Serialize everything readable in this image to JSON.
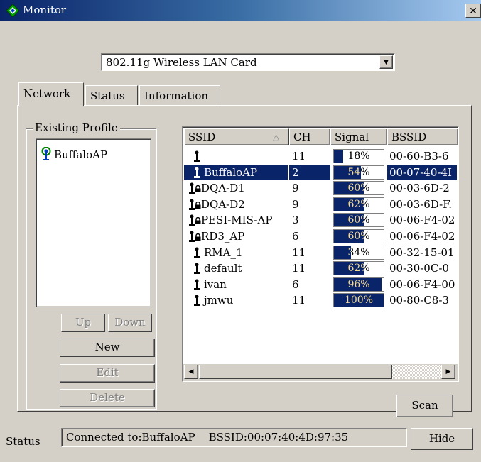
{
  "window": {
    "title": "Monitor",
    "close": "✕"
  },
  "adapter": {
    "selected": "802.11g Wireless LAN Card",
    "arrow": "▼"
  },
  "tabs": [
    "Network",
    "Status",
    "Information"
  ],
  "profiles": {
    "legend": "Existing Profile",
    "items": [
      "BuffaloAP"
    ],
    "buttons": {
      "up": "Up",
      "down": "Down",
      "new": "New",
      "edit": "Edit",
      "delete": "Delete"
    }
  },
  "table": {
    "headers": {
      "ssid": "SSID",
      "ch": "CH",
      "signal": "Signal",
      "bssid": "BSSID",
      "sort_icon": "△"
    },
    "rows": [
      {
        "ssid": "",
        "ch": "11",
        "signal": "18%",
        "signal_value": 18,
        "bssid": "00-60-B3-6",
        "secured": false,
        "selected": false
      },
      {
        "ssid": "BuffaloAP",
        "ch": "2",
        "signal": "54%",
        "signal_value": 54,
        "bssid": "00-07-40-4I",
        "secured": false,
        "selected": true
      },
      {
        "ssid": "DQA-D1",
        "ch": "9",
        "signal": "60%",
        "signal_value": 60,
        "bssid": "00-03-6D-2",
        "secured": true,
        "selected": false
      },
      {
        "ssid": "DQA-D2",
        "ch": "9",
        "signal": "62%",
        "signal_value": 62,
        "bssid": "00-03-6D-F.",
        "secured": true,
        "selected": false
      },
      {
        "ssid": "PESI-MIS-AP",
        "ch": "3",
        "signal": "60%",
        "signal_value": 60,
        "bssid": "00-06-F4-02",
        "secured": true,
        "selected": false
      },
      {
        "ssid": "RD3_AP",
        "ch": "6",
        "signal": "60%",
        "signal_value": 60,
        "bssid": "00-06-F4-02",
        "secured": true,
        "selected": false
      },
      {
        "ssid": "RMA_1",
        "ch": "11",
        "signal": "34%",
        "signal_value": 34,
        "bssid": "00-32-15-01",
        "secured": false,
        "selected": false
      },
      {
        "ssid": "default",
        "ch": "11",
        "signal": "62%",
        "signal_value": 62,
        "bssid": "00-30-0C-0",
        "secured": false,
        "selected": false
      },
      {
        "ssid": "ivan",
        "ch": "6",
        "signal": "96%",
        "signal_value": 96,
        "bssid": "00-06-F4-00",
        "secured": false,
        "selected": false
      },
      {
        "ssid": "jmwu",
        "ch": "11",
        "signal": "100%",
        "signal_value": 100,
        "bssid": "00-80-C8-3",
        "secured": false,
        "selected": false
      }
    ],
    "scroll_left": "◀",
    "scroll_right": "▶"
  },
  "actions": {
    "scan": "Scan",
    "hide": "Hide"
  },
  "status": {
    "label": "Status",
    "text": "Connected to:BuffaloAP    BSSID:00:07:40:4D:97:35"
  }
}
